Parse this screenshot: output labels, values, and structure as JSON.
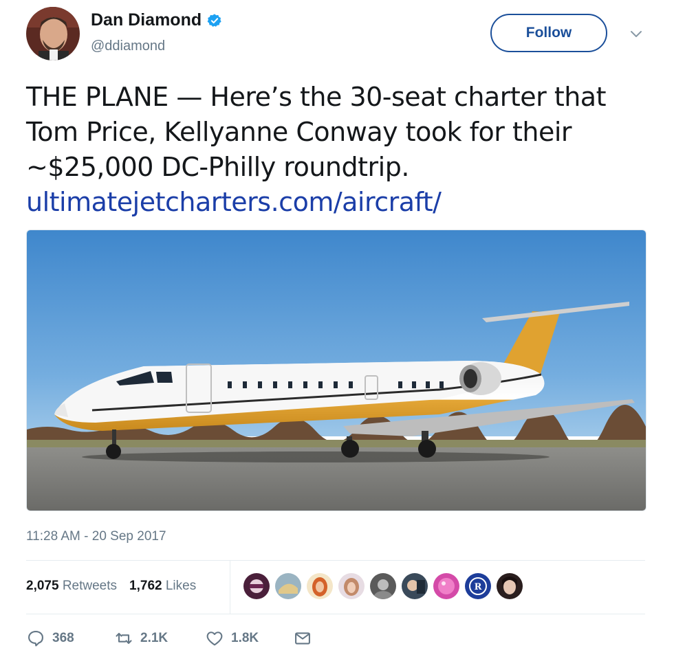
{
  "author": {
    "display_name": "Dan Diamond",
    "handle": "@ddiamond",
    "verified_icon": "verified-badge-icon"
  },
  "follow_button": {
    "label": "Follow"
  },
  "tweet": {
    "text_before_link": "THE PLANE — Here’s the 30-seat charter that Tom Price, Kellyanne Conway took for their ~$25,000 DC-Philly roundtrip.",
    "link": "ultimatejetcharters.com/aircraft/"
  },
  "timestamp": "11:28 AM - 20 Sep 2017",
  "stats": {
    "retweets_count": "2,075",
    "retweets_label": "Retweets",
    "likes_count": "1,762",
    "likes_label": "Likes"
  },
  "actions": {
    "replies": "368",
    "retweets": "2.1K",
    "likes": "1.8K"
  },
  "colors": {
    "link": "#1b3ea8",
    "follow": "#1b4f9a",
    "muted": "#657786",
    "verified": "#1da1f2"
  }
}
